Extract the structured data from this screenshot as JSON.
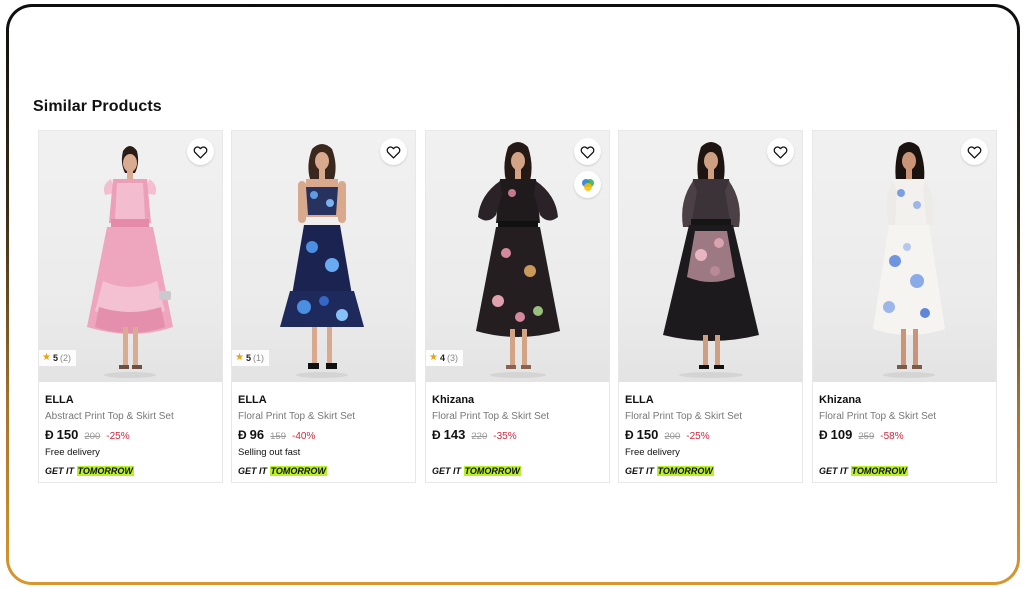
{
  "section_title": "Similar Products",
  "currency_symbol": "Đ",
  "delivery_label": "GET IT",
  "delivery_highlight": "TOMORROW",
  "colors": {
    "discount": "#d2283f",
    "tomorrow_bg": "#b8f02b",
    "star": "#e8a317"
  },
  "products": [
    {
      "brand": "ELLA",
      "name": "Abstract Print Top & Skirt Set",
      "price": "150",
      "old_price": "200",
      "discount": "-25%",
      "note": "Free delivery",
      "rating": {
        "value": "5",
        "count": "(2)"
      },
      "icons": [
        "heart-icon"
      ]
    },
    {
      "brand": "ELLA",
      "name": "Floral Print Top & Skirt Set",
      "price": "96",
      "old_price": "159",
      "discount": "-40%",
      "note": "Selling out fast",
      "rating": {
        "value": "5",
        "count": "(1)"
      },
      "icons": [
        "heart-icon"
      ]
    },
    {
      "brand": "Khizana",
      "name": "Floral Print Top & Skirt Set",
      "price": "143",
      "old_price": "220",
      "discount": "-35%",
      "note": "",
      "rating": {
        "value": "4",
        "count": "(3)"
      },
      "icons": [
        "heart-icon",
        "visual-search-icon"
      ]
    },
    {
      "brand": "ELLA",
      "name": "Floral Print Top & Skirt Set",
      "price": "150",
      "old_price": "200",
      "discount": "-25%",
      "note": "Free delivery",
      "icons": [
        "heart-icon"
      ]
    },
    {
      "brand": "Khizana",
      "name": "Floral Print Top & Skirt Set",
      "price": "109",
      "old_price": "259",
      "discount": "-58%",
      "note": "",
      "icons": [
        "heart-icon"
      ]
    }
  ]
}
